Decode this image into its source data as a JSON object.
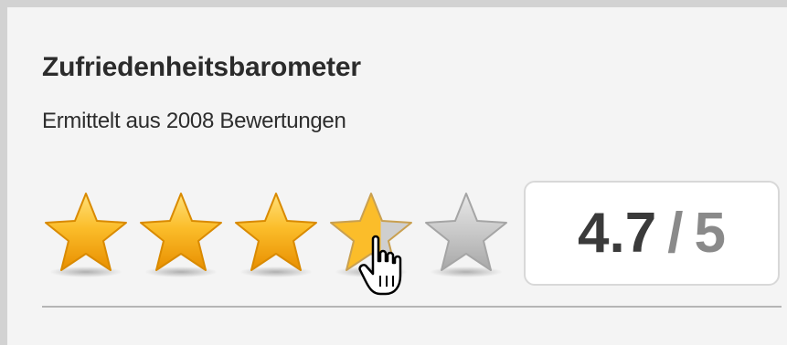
{
  "widget": {
    "title": "Zufriedenheitsbarometer",
    "subtitle": "Ermittelt aus 2008 Bewertungen"
  },
  "rating": {
    "value": "4.7",
    "separator": "/",
    "max": "5",
    "stars_total": 5,
    "stars_highlighted": 3.5
  },
  "colors": {
    "star_filled": "#f7b21d",
    "star_empty": "#c4c4c4",
    "panel_background": "#f4f4f4",
    "panel_border": "#d2d2d2"
  },
  "icons": {
    "star": "star-icon",
    "cursor": "hand-pointer-icon"
  }
}
